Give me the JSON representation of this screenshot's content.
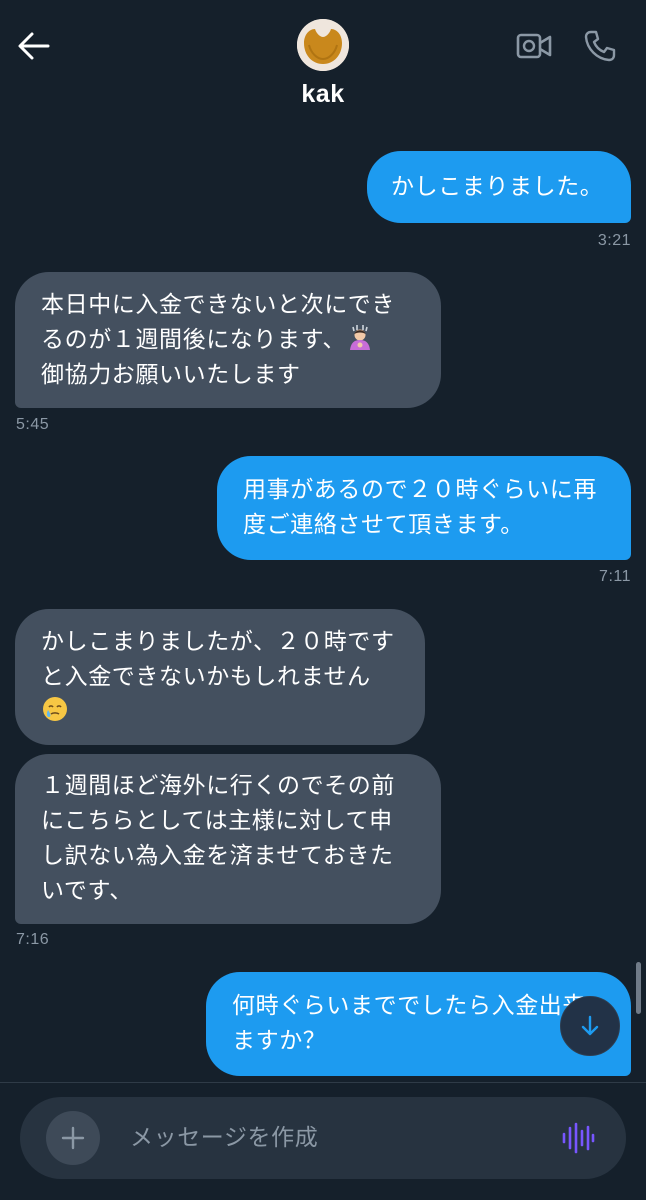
{
  "header": {
    "contact_name": "kak",
    "back_icon": "arrow-left-icon",
    "video_icon": "video-call-icon",
    "call_icon": "phone-icon"
  },
  "messages": [
    {
      "direction": "outgoing",
      "text": "かしこまりました。",
      "time": "3:21"
    },
    {
      "direction": "incoming",
      "text": "本日中に入金できないと次にできるのが１週間後になります、",
      "text2": "御協力お願いいたします",
      "emoji": "person-bowing-emoji",
      "time": "5:45"
    },
    {
      "direction": "outgoing",
      "text": "用事があるので２０時ぐらいに再度ご連絡させて頂きます。",
      "time": "7:11"
    },
    {
      "direction": "incoming",
      "text": "かしこまりましたが、２０時ですと入金できないかもしれません",
      "emoji": "face-holding-back-tears-emoji"
    },
    {
      "direction": "incoming",
      "text": "１週間ほど海外に行くのでその前にこちらとしては主様に対して申し訳ない為入金を済ませておきたいです、",
      "time": "7:16"
    },
    {
      "direction": "outgoing",
      "text": "何時ぐらいまででしたら入金出来ますか？"
    }
  ],
  "composer": {
    "placeholder": "メッセージを作成",
    "add_icon": "plus-icon",
    "voice_icon": "voice-waveform-icon"
  },
  "scroll_down_icon": "arrow-down-icon",
  "colors": {
    "background": "#15202b",
    "outgoing_bubble": "#1d9bf0",
    "incoming_bubble": "#44505f",
    "timestamp": "#8b98a5",
    "voice_accent": "#7856ff"
  }
}
